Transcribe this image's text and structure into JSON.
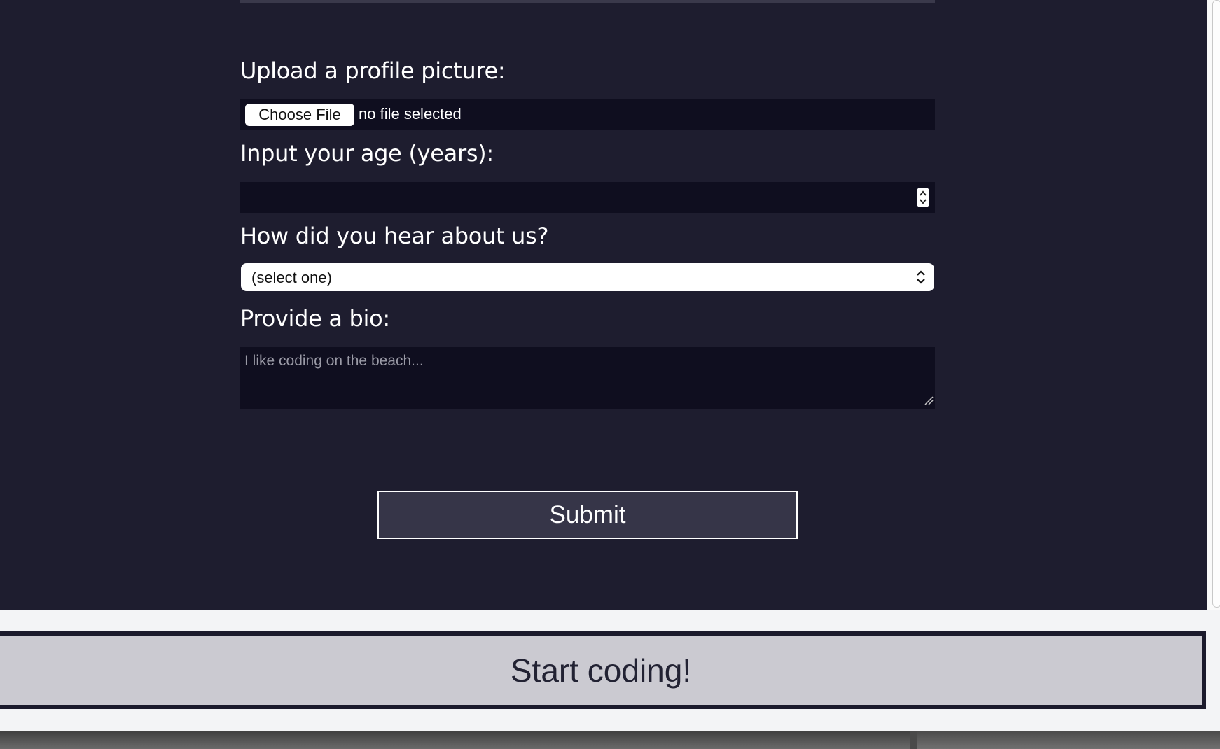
{
  "form": {
    "upload_label": "Upload a profile picture:",
    "file_button_label": "Choose File",
    "file_status": "no file selected",
    "age_label": "Input your age (years):",
    "age_value": "",
    "hear_label": "How did you hear about us?",
    "hear_selected": "(select one)",
    "bio_label": "Provide a bio:",
    "bio_placeholder": "I like coding on the beach...",
    "submit_label": "Submit"
  },
  "footer": {
    "start_label": "Start coding!"
  },
  "colors": {
    "preview_bg": "#1e1d2f",
    "field_bg": "#0f0e1f",
    "submit_bg": "#363548",
    "start_bg": "#cbcad1"
  },
  "icons": [
    "number-spinner-icon",
    "select-chevrons-icon",
    "resize-grip-icon"
  ]
}
